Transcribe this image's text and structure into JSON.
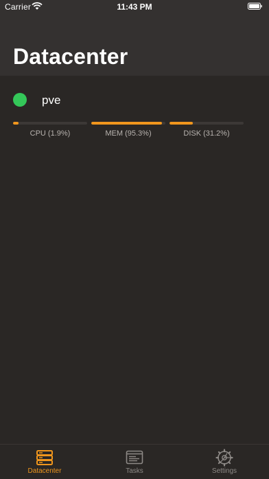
{
  "status_bar": {
    "carrier": "Carrier",
    "time": "11:43 PM"
  },
  "header": {
    "title": "Datacenter"
  },
  "node": {
    "name": "pve",
    "status": "online",
    "status_color": "#34c759"
  },
  "metrics": [
    {
      "label": "CPU (1.9%)",
      "percent": 1.9
    },
    {
      "label": "MEM (95.3%)",
      "percent": 95.3
    },
    {
      "label": "DISK (31.2%)",
      "percent": 31.2
    }
  ],
  "tabbar": {
    "tabs": [
      {
        "label": "Datacenter",
        "icon": "server-icon",
        "active": true
      },
      {
        "label": "Tasks",
        "icon": "window-icon",
        "active": false
      },
      {
        "label": "Settings",
        "icon": "gear-icon",
        "active": false
      }
    ]
  },
  "colors": {
    "accent": "#f0961d",
    "background": "#2a2725",
    "header": "#343130",
    "online": "#34c759"
  }
}
